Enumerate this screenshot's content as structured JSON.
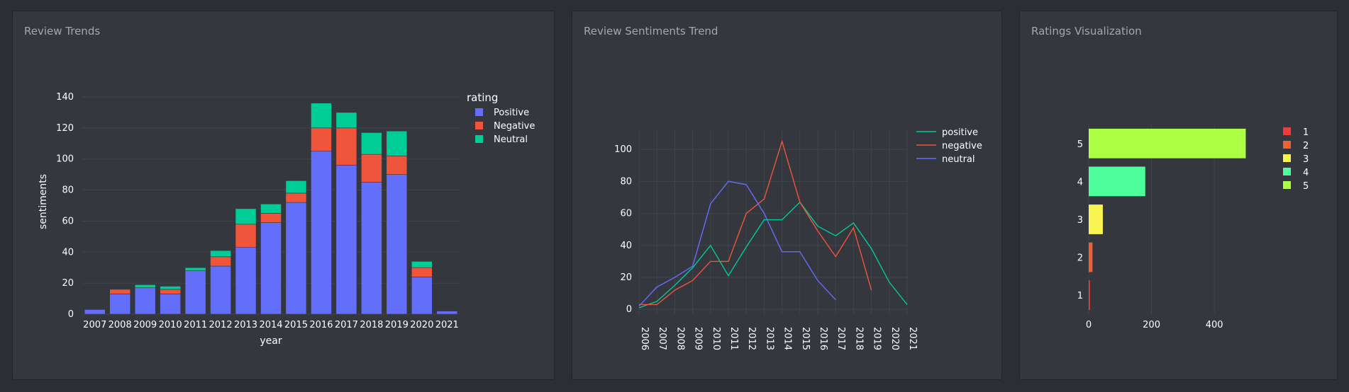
{
  "panels": {
    "trends_title": "Review Trends",
    "sentiments_title": "Review Sentiments Trend",
    "ratings_title": "Ratings Visualization"
  },
  "chart_data": [
    {
      "type": "bar",
      "stacked": true,
      "title": "",
      "xlabel": "year",
      "ylabel": "sentiments",
      "ylim": [
        0,
        145
      ],
      "yticks": [
        0,
        20,
        40,
        60,
        80,
        100,
        120,
        140
      ],
      "grid": true,
      "legend_title": "rating",
      "legend_position": "top-right",
      "categories": [
        "2007",
        "2008",
        "2009",
        "2010",
        "2011",
        "2012",
        "2013",
        "2014",
        "2015",
        "2016",
        "2017",
        "2018",
        "2019",
        "2020",
        "2021"
      ],
      "series": [
        {
          "name": "Positive",
          "color": "#636efa",
          "values": [
            3,
            13,
            17,
            13,
            28,
            31,
            43,
            59,
            72,
            105,
            96,
            85,
            90,
            24,
            2
          ]
        },
        {
          "name": "Negative",
          "color": "#ef553b",
          "values": [
            0,
            3,
            0,
            3,
            0,
            6,
            15,
            6,
            6,
            15,
            24,
            18,
            12,
            6,
            0
          ]
        },
        {
          "name": "Neutral",
          "color": "#00cc96",
          "values": [
            0,
            0,
            2,
            2,
            2,
            4,
            10,
            6,
            8,
            16,
            10,
            14,
            16,
            4,
            0
          ]
        }
      ]
    },
    {
      "type": "line",
      "title": "",
      "xlabel": "",
      "ylabel": "",
      "x": [
        "2006",
        "2007",
        "2008",
        "2009",
        "2010",
        "2011",
        "2012",
        "2013",
        "2014",
        "2015",
        "2016",
        "2017",
        "2018",
        "2019",
        "2020",
        "2021"
      ],
      "ylim": [
        -3,
        112
      ],
      "yticks": [
        0,
        20,
        40,
        60,
        80,
        100
      ],
      "grid": true,
      "legend_position": "top-right",
      "series": [
        {
          "name": "positive",
          "color": "#00cc96",
          "values": [
            1,
            5,
            15,
            26,
            40,
            21,
            39,
            56,
            56,
            67,
            52,
            46,
            54,
            38,
            17,
            3
          ]
        },
        {
          "name": "negative",
          "color": "#ef553b",
          "values": [
            3,
            3,
            12,
            18,
            30,
            30,
            60,
            69,
            105,
            67,
            49,
            33,
            51,
            12,
            null,
            null
          ]
        },
        {
          "name": "neutral",
          "color": "#636efa",
          "values": [
            2,
            14,
            20,
            27,
            66,
            80,
            78,
            60,
            36,
            36,
            18,
            6,
            null,
            null,
            null,
            null
          ]
        }
      ]
    },
    {
      "type": "bar",
      "orientation": "horizontal",
      "title": "",
      "xlabel": "",
      "ylabel": "",
      "categories": [
        "1",
        "2",
        "3",
        "4",
        "5"
      ],
      "values": [
        4,
        12,
        45,
        180,
        500
      ],
      "colors": [
        "#ef3b3b",
        "#f06030",
        "#f8f550",
        "#4dff9a",
        "#adff44"
      ],
      "xlim": [
        0,
        560
      ],
      "xticks": [
        0,
        200,
        400
      ],
      "grid": true,
      "legend_position": "top-right",
      "legend": [
        "1",
        "2",
        "3",
        "4",
        "5"
      ]
    }
  ]
}
